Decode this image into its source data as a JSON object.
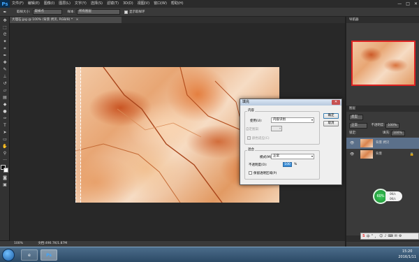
{
  "app": {
    "logo": "Ps"
  },
  "menubar": {
    "items": [
      "文件(F)",
      "编辑(E)",
      "图像(I)",
      "图层(L)",
      "文字(Y)",
      "选择(S)",
      "滤镜(T)",
      "3D(D)",
      "视图(V)",
      "窗口(W)",
      "帮助(H)"
    ],
    "win_controls": [
      "—",
      "□",
      "✕"
    ]
  },
  "options": {
    "tool_icon": "eyedropper-icon",
    "size_label": "取样大小:",
    "size_value": "取样点",
    "sample_label": "样本:",
    "sample_value": "所有图层",
    "ring_label": "显示取样环"
  },
  "document": {
    "tab_title": "大理石.jpg @ 100% (背景 拷贝, RGB/8) *",
    "close_glyph": "×"
  },
  "status": {
    "zoom": "100%",
    "doc_size": "文档:490.7K/1.87M"
  },
  "panels": {
    "nav_tab": "导航器",
    "layers_tab": "图层",
    "kind_label": "类型",
    "blend_mode": "正常",
    "opacity_label": "不透明度:",
    "opacity_value": "100%",
    "lock_label": "锁定:",
    "fill_label": "填充:",
    "fill_value": "100%",
    "layers": [
      {
        "name": "背景 拷贝",
        "selected": true
      },
      {
        "name": "背景",
        "selected": false
      }
    ]
  },
  "speed_widget": {
    "percent": "60%",
    "up": "0K/s",
    "down": "0K/s"
  },
  "sogou": {
    "logo": "S",
    "items": [
      "中",
      "°",
      "，",
      "☺",
      "♪",
      "⌨",
      "✉",
      "⚙"
    ]
  },
  "taskbar": {
    "time": "15:20",
    "date": "2016/1/11"
  },
  "dialog": {
    "title": "填充",
    "close": "✕",
    "content_group": "内容",
    "use_label": "使用(U):",
    "use_value": "内容识别",
    "custom_pattern_label": "自定图案:",
    "color_adapt_label": "颜色适应(C)",
    "blending_group": "混合",
    "mode_label": "模式(M):",
    "mode_value": "正常",
    "opacity_label": "不透明度(O):",
    "opacity_value": "100",
    "opacity_unit": "%",
    "preserve_label": "保留透明区域(P)",
    "ok_label": "确定",
    "cancel_label": "取消"
  }
}
